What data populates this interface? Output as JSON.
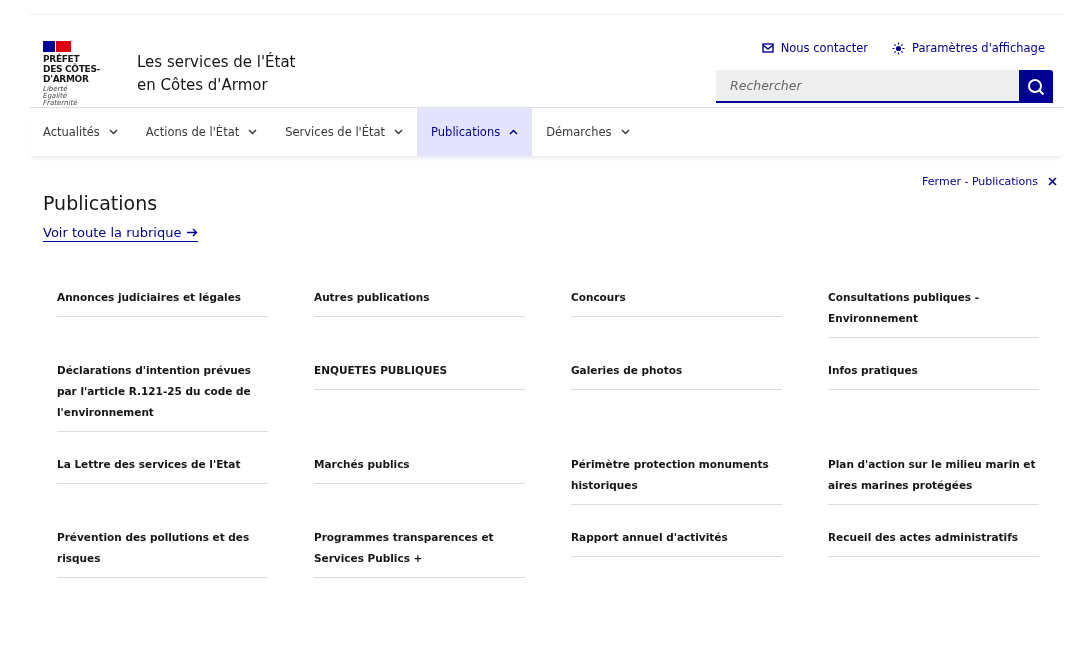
{
  "logo": {
    "lines": [
      "PRÉFET",
      "DES CÔTES-",
      "D'ARMOR"
    ],
    "motto": [
      "Liberté",
      "Égalité",
      "Fraternité"
    ]
  },
  "site_title": [
    "Les services de l'État",
    "en Côtes d'Armor"
  ],
  "quick_links": [
    {
      "label": "Nous contacter",
      "kind": "mail"
    },
    {
      "label": "Paramètres d'affichage",
      "kind": "display"
    }
  ],
  "search": {
    "placeholder": "Rechercher"
  },
  "nav": [
    {
      "label": "Actualités",
      "selected": false
    },
    {
      "label": "Actions de l'État",
      "selected": false
    },
    {
      "label": "Services de l'État",
      "selected": false
    },
    {
      "label": "Publications",
      "selected": true
    },
    {
      "label": "Démarches",
      "selected": false
    }
  ],
  "menu": {
    "close": "Fermer - Publications",
    "title": "Publications",
    "see_all": "Voir toute la rubrique",
    "links": [
      "Annonces judiciaires et légales",
      "Autres publications",
      "Concours",
      "Consultations publiques - Environnement",
      "Déclarations d'intention prévues par l'article R.121-25 du code de l'environnement",
      "ENQUETES PUBLIQUES",
      "Galeries de photos",
      "Infos pratiques",
      "La Lettre des services de l'Etat",
      "Marchés publics",
      "Périmètre protection monuments historiques",
      "Plan d'action sur le milieu marin et aires marines protégées",
      "Prévention des pollutions et des risques",
      "Programmes transparences et Services Publics +",
      "Rapport annuel d'activités",
      "Recueil des actes administratifs"
    ]
  }
}
